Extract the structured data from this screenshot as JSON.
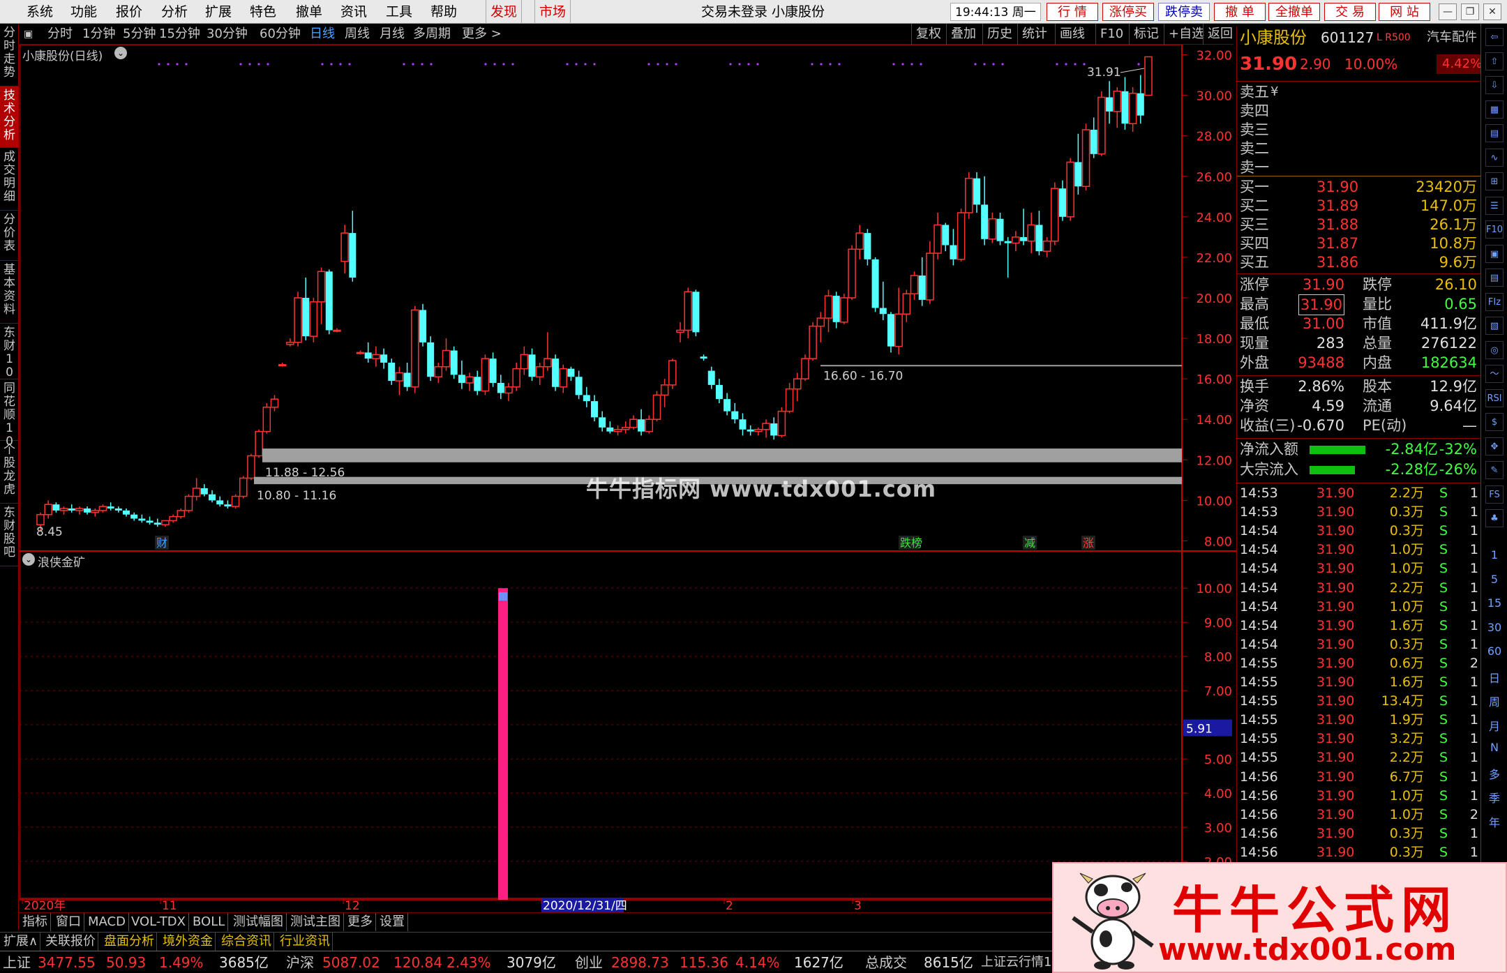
{
  "menubar": {
    "items": [
      "系统",
      "功能",
      "报价",
      "分析",
      "扩展",
      "特色",
      "撤单",
      "资讯",
      "工具",
      "帮助"
    ],
    "highlight_items": [
      "发现",
      "市场"
    ],
    "title": "交易未登录  小康股份",
    "clock": "19:44:13 周一",
    "quick_buttons": [
      "行  情",
      "涨停买",
      "跌停卖",
      "撤  单",
      "全撤单",
      "交  易",
      "网  站"
    ],
    "window_buttons": [
      "—",
      "❐",
      "✕"
    ]
  },
  "left_tabs": [
    "分时走势",
    "技术分析",
    "成交明细",
    "分价表",
    "基本资料",
    "东财10",
    "同花顺10",
    "个股龙虎",
    "东财股吧"
  ],
  "left_tabs_active": "技术分析",
  "period_bar": {
    "periods": [
      "分时",
      "1分钟",
      "5分钟",
      "15分钟",
      "30分钟",
      "60分钟",
      "日线",
      "周线",
      "月线",
      "多周期",
      "更多 >"
    ],
    "selected": "日线",
    "tools": [
      "复权",
      "叠加",
      "历史",
      "统计",
      "画线",
      "F10",
      "标记",
      "+自选",
      "返回"
    ]
  },
  "main_chart": {
    "title": "小康股份(日线)",
    "price_axis_ticks": [
      "32.00",
      "30.00",
      "28.00",
      "26.00",
      "24.00",
      "22.00",
      "20.00",
      "18.00",
      "16.00",
      "14.00",
      "12.00",
      "10.00",
      "8.00"
    ],
    "annotations": {
      "high_label": "31.91",
      "low_label": "8.45",
      "band1_label": "16.60 - 16.70",
      "band2_label": "11.88 - 12.56",
      "band3_label": "10.80 - 11.16",
      "event_marks": [
        "财",
        "跌榜",
        "减",
        "涨"
      ]
    }
  },
  "indicator": {
    "title": "浪侠金矿",
    "axis_ticks": [
      "10.00",
      "9.00",
      "8.00",
      "7.00",
      "6.00",
      "5.00",
      "4.00",
      "3.00",
      "2.00"
    ],
    "current_value": "5.91",
    "bar_value": 10.0,
    "bar_color": "#ff1e82"
  },
  "date_axis": [
    "2020年",
    "11",
    "12",
    "2020/12/31/四",
    "2",
    "3"
  ],
  "chart_data": {
    "type": "candlestick",
    "symbol": "小康股份",
    "period": "日线",
    "y_range": [
      7.5,
      32.5
    ],
    "candles": [
      [
        8.8,
        9.4,
        8.5,
        9.3
      ],
      [
        9.3,
        10.0,
        9.1,
        9.8
      ],
      [
        9.8,
        9.9,
        9.4,
        9.5
      ],
      [
        9.5,
        9.7,
        9.3,
        9.6
      ],
      [
        9.6,
        9.8,
        9.4,
        9.5
      ],
      [
        9.5,
        9.7,
        9.3,
        9.6
      ],
      [
        9.6,
        9.7,
        9.3,
        9.4
      ],
      [
        9.4,
        9.6,
        9.2,
        9.5
      ],
      [
        9.5,
        9.8,
        9.4,
        9.7
      ],
      [
        9.7,
        9.9,
        9.5,
        9.6
      ],
      [
        9.6,
        9.7,
        9.4,
        9.5
      ],
      [
        9.5,
        9.6,
        9.2,
        9.3
      ],
      [
        9.3,
        9.4,
        9.0,
        9.1
      ],
      [
        9.1,
        9.3,
        8.9,
        9.0
      ],
      [
        9.0,
        9.2,
        8.8,
        8.9
      ],
      [
        8.9,
        9.1,
        8.7,
        8.8
      ],
      [
        8.8,
        9.0,
        8.7,
        9.0
      ],
      [
        9.0,
        9.3,
        8.9,
        9.2
      ],
      [
        9.2,
        9.6,
        9.1,
        9.5
      ],
      [
        9.5,
        10.3,
        9.4,
        10.2
      ],
      [
        10.2,
        11.1,
        10.0,
        10.6
      ],
      [
        10.6,
        10.8,
        10.2,
        10.3
      ],
      [
        10.3,
        10.5,
        9.9,
        10.0
      ],
      [
        10.0,
        10.2,
        9.7,
        9.8
      ],
      [
        9.8,
        10.0,
        9.6,
        9.7
      ],
      [
        9.7,
        10.3,
        9.6,
        10.2
      ],
      [
        10.2,
        11.2,
        10.1,
        11.1
      ],
      [
        11.1,
        12.3,
        11.0,
        12.2
      ],
      [
        12.2,
        13.5,
        12.1,
        13.4
      ],
      [
        13.4,
        14.8,
        13.3,
        14.6
      ],
      [
        14.6,
        15.2,
        14.4,
        15.0
      ],
      [
        16.7,
        16.8,
        16.6,
        16.7
      ],
      [
        17.7,
        18.0,
        17.6,
        17.8
      ],
      [
        17.8,
        20.3,
        17.6,
        20.0
      ],
      [
        20.0,
        21.0,
        17.9,
        18.1
      ],
      [
        18.1,
        20.0,
        17.8,
        19.8
      ],
      [
        19.8,
        21.5,
        18.7,
        21.3
      ],
      [
        21.3,
        21.4,
        18.2,
        18.4
      ],
      [
        18.4,
        18.5,
        18.3,
        18.4
      ],
      [
        21.8,
        23.6,
        21.2,
        23.2
      ],
      [
        23.2,
        24.3,
        20.8,
        21.0
      ],
      [
        17.3,
        17.4,
        17.2,
        17.3
      ],
      [
        17.3,
        17.8,
        16.8,
        17.0
      ],
      [
        17.0,
        17.6,
        16.6,
        17.2
      ],
      [
        17.2,
        17.5,
        16.5,
        16.8
      ],
      [
        16.8,
        17.0,
        15.7,
        15.9
      ],
      [
        15.9,
        16.6,
        15.2,
        16.3
      ],
      [
        16.3,
        16.8,
        15.4,
        15.6
      ],
      [
        15.6,
        19.6,
        15.3,
        19.4
      ],
      [
        19.4,
        19.7,
        17.6,
        17.8
      ],
      [
        17.8,
        18.1,
        15.9,
        16.1
      ],
      [
        16.1,
        16.8,
        15.8,
        16.6
      ],
      [
        16.6,
        18.0,
        16.4,
        17.4
      ],
      [
        17.4,
        17.6,
        16.0,
        16.2
      ],
      [
        16.2,
        16.9,
        15.5,
        15.8
      ],
      [
        15.8,
        16.3,
        15.4,
        16.1
      ],
      [
        16.1,
        16.4,
        15.2,
        15.4
      ],
      [
        15.4,
        17.2,
        15.2,
        17.0
      ],
      [
        17.0,
        17.3,
        15.6,
        15.8
      ],
      [
        15.8,
        16.2,
        15.0,
        15.3
      ],
      [
        15.3,
        15.8,
        14.9,
        15.6
      ],
      [
        15.6,
        16.8,
        15.4,
        16.5
      ],
      [
        16.5,
        17.6,
        16.2,
        17.2
      ],
      [
        17.2,
        17.5,
        15.9,
        16.1
      ],
      [
        16.1,
        16.8,
        15.7,
        16.6
      ],
      [
        16.6,
        18.3,
        16.4,
        17.0
      ],
      [
        17.0,
        17.2,
        15.4,
        15.6
      ],
      [
        15.6,
        16.7,
        15.3,
        16.5
      ],
      [
        16.5,
        16.6,
        15.9,
        16.1
      ],
      [
        16.1,
        16.4,
        15.0,
        15.2
      ],
      [
        15.2,
        15.6,
        14.6,
        14.9
      ],
      [
        14.9,
        15.2,
        13.9,
        14.1
      ],
      [
        14.1,
        14.4,
        13.4,
        13.6
      ],
      [
        13.6,
        13.9,
        13.3,
        13.4
      ],
      [
        13.4,
        13.7,
        13.2,
        13.5
      ],
      [
        13.5,
        13.9,
        13.3,
        13.6
      ],
      [
        13.6,
        14.2,
        13.5,
        14.0
      ],
      [
        14.0,
        14.5,
        13.2,
        13.4
      ],
      [
        13.4,
        14.2,
        13.3,
        14.0
      ],
      [
        14.0,
        15.4,
        13.9,
        15.2
      ],
      [
        15.2,
        16.0,
        14.6,
        15.7
      ],
      [
        15.7,
        17.0,
        15.5,
        16.9
      ],
      [
        18.3,
        18.8,
        17.8,
        18.4
      ],
      [
        18.4,
        20.5,
        18.0,
        20.3
      ],
      [
        20.3,
        20.4,
        18.1,
        18.3
      ],
      [
        17.1,
        17.2,
        16.9,
        17.0
      ],
      [
        16.4,
        16.6,
        15.5,
        15.7
      ],
      [
        15.7,
        16.0,
        14.8,
        15.0
      ],
      [
        15.0,
        15.3,
        14.2,
        14.4
      ],
      [
        14.4,
        14.8,
        13.8,
        14.0
      ],
      [
        14.0,
        14.3,
        13.2,
        13.5
      ],
      [
        13.5,
        13.7,
        13.2,
        13.4
      ],
      [
        13.4,
        13.6,
        13.2,
        13.5
      ],
      [
        13.5,
        14.0,
        13.1,
        13.8
      ],
      [
        13.8,
        14.1,
        13.0,
        13.2
      ],
      [
        13.2,
        14.6,
        13.1,
        14.4
      ],
      [
        14.4,
        15.8,
        14.3,
        15.5
      ],
      [
        15.5,
        16.3,
        14.9,
        16.0
      ],
      [
        16.0,
        17.2,
        15.9,
        17.0
      ],
      [
        17.0,
        18.8,
        16.9,
        18.6
      ],
      [
        18.6,
        19.3,
        17.8,
        19.0
      ],
      [
        19.0,
        20.4,
        18.3,
        20.1
      ],
      [
        20.1,
        20.3,
        18.5,
        18.8
      ],
      [
        18.8,
        20.2,
        18.7,
        20.0
      ],
      [
        20.0,
        22.6,
        19.9,
        22.4
      ],
      [
        22.4,
        23.6,
        21.9,
        23.2
      ],
      [
        23.2,
        23.4,
        21.6,
        21.9
      ],
      [
        21.9,
        22.0,
        19.3,
        19.5
      ],
      [
        19.5,
        20.8,
        18.9,
        19.2
      ],
      [
        19.2,
        19.3,
        17.3,
        17.6
      ],
      [
        17.6,
        20.5,
        17.2,
        19.2
      ],
      [
        19.2,
        20.4,
        18.8,
        20.2
      ],
      [
        20.2,
        21.3,
        19.9,
        21.1
      ],
      [
        21.1,
        22.0,
        19.6,
        19.9
      ],
      [
        19.9,
        22.8,
        19.7,
        22.2
      ],
      [
        22.2,
        24.2,
        21.9,
        23.6
      ],
      [
        23.6,
        23.7,
        22.3,
        22.6
      ],
      [
        22.6,
        23.4,
        21.6,
        21.9
      ],
      [
        21.9,
        24.4,
        21.8,
        24.2
      ],
      [
        24.2,
        26.2,
        23.9,
        25.9
      ],
      [
        25.9,
        26.2,
        24.2,
        24.6
      ],
      [
        24.6,
        26.0,
        22.6,
        22.9
      ],
      [
        22.9,
        24.2,
        22.7,
        23.9
      ],
      [
        23.9,
        24.2,
        22.6,
        22.8
      ],
      [
        22.8,
        23.0,
        21.0,
        22.7
      ],
      [
        22.7,
        23.3,
        22.3,
        23.0
      ],
      [
        23.0,
        24.4,
        22.6,
        22.8
      ],
      [
        22.8,
        24.2,
        22.2,
        23.6
      ],
      [
        23.6,
        24.3,
        22.1,
        22.3
      ],
      [
        22.3,
        23.0,
        22.0,
        22.8
      ],
      [
        22.8,
        25.7,
        22.6,
        25.4
      ],
      [
        25.4,
        25.8,
        23.8,
        24.0
      ],
      [
        24.0,
        26.9,
        23.8,
        26.7
      ],
      [
        26.7,
        28.1,
        25.1,
        25.5
      ],
      [
        25.5,
        28.6,
        25.3,
        28.3
      ],
      [
        28.3,
        28.9,
        26.9,
        27.1
      ],
      [
        27.1,
        30.2,
        27.0,
        29.9
      ],
      [
        29.9,
        30.7,
        28.6,
        29.2
      ],
      [
        29.2,
        30.4,
        28.4,
        30.2
      ],
      [
        30.2,
        30.9,
        28.3,
        28.6
      ],
      [
        28.6,
        30.4,
        28.2,
        30.1
      ],
      [
        30.1,
        31.0,
        28.6,
        29.0
      ],
      [
        30.0,
        31.9,
        31.0,
        31.9
      ]
    ]
  },
  "quote": {
    "name": "小康股份",
    "code": "601127",
    "tags": "L R500",
    "sector": "汽车配件",
    "price": "31.90",
    "change": "2.90",
    "change_pct": "10.00%",
    "amplitude": "4.42%",
    "asks": [
      {
        "label": "卖五",
        "price": "",
        "vol": ""
      },
      {
        "label": "卖四",
        "price": "",
        "vol": ""
      },
      {
        "label": "卖三",
        "price": "",
        "vol": ""
      },
      {
        "label": "卖二",
        "price": "",
        "vol": ""
      },
      {
        "label": "卖一",
        "price": "",
        "vol": ""
      }
    ],
    "ask_currency": "¥",
    "bids": [
      {
        "label": "买一",
        "price": "31.90",
        "vol": "23420万"
      },
      {
        "label": "买二",
        "price": "31.89",
        "vol": "147.0万"
      },
      {
        "label": "买三",
        "price": "31.88",
        "vol": "26.1万"
      },
      {
        "label": "买四",
        "price": "31.87",
        "vol": "10.8万"
      },
      {
        "label": "买五",
        "price": "31.86",
        "vol": "9.6万"
      }
    ],
    "stats": [
      {
        "l1": "涨停",
        "v1": "31.90",
        "l2": "跌停",
        "v2": "26.10"
      },
      {
        "l1": "最高",
        "v1": "31.90",
        "l2": "量比",
        "v2": "0.65"
      },
      {
        "l1": "最低",
        "v1": "31.00",
        "l2": "市值",
        "v2": "411.9亿"
      },
      {
        "l1": "现量",
        "v1": "283",
        "l2": "总量",
        "v2": "276122"
      },
      {
        "l1": "外盘",
        "v1": "93488",
        "l2": "内盘",
        "v2": "182634"
      }
    ],
    "stats2": [
      {
        "l1": "换手",
        "v1": "2.86%",
        "l2": "股本",
        "v2": "12.9亿"
      },
      {
        "l1": "净资",
        "v1": "4.59",
        "l2": "流通",
        "v2": "9.64亿"
      },
      {
        "l1": "收益(三)",
        "v1": "-0.670",
        "l2": "PE(动)",
        "v2": "—"
      }
    ],
    "flows": [
      {
        "label": "净流入额",
        "value": "-2.84亿",
        "pct": "-32%",
        "fill": 0.32
      },
      {
        "label": "大宗流入",
        "value": "-2.28亿",
        "pct": "-26%",
        "fill": 0.26
      }
    ]
  },
  "ticks": [
    {
      "t": "14:53",
      "p": "31.90",
      "v": "2.2万",
      "s": "S",
      "n": "1"
    },
    {
      "t": "14:53",
      "p": "31.90",
      "v": "0.3万",
      "s": "S",
      "n": "1"
    },
    {
      "t": "14:54",
      "p": "31.90",
      "v": "0.3万",
      "s": "S",
      "n": "1"
    },
    {
      "t": "14:54",
      "p": "31.90",
      "v": "1.0万",
      "s": "S",
      "n": "1"
    },
    {
      "t": "14:54",
      "p": "31.90",
      "v": "1.0万",
      "s": "S",
      "n": "1"
    },
    {
      "t": "14:54",
      "p": "31.90",
      "v": "2.2万",
      "s": "S",
      "n": "1"
    },
    {
      "t": "14:54",
      "p": "31.90",
      "v": "1.0万",
      "s": "S",
      "n": "1"
    },
    {
      "t": "14:54",
      "p": "31.90",
      "v": "1.6万",
      "s": "S",
      "n": "1"
    },
    {
      "t": "14:54",
      "p": "31.90",
      "v": "0.3万",
      "s": "S",
      "n": "1"
    },
    {
      "t": "14:55",
      "p": "31.90",
      "v": "0.6万",
      "s": "S",
      "n": "2"
    },
    {
      "t": "14:55",
      "p": "31.90",
      "v": "1.6万",
      "s": "S",
      "n": "1"
    },
    {
      "t": "14:55",
      "p": "31.90",
      "v": "13.4万",
      "s": "S",
      "n": "1"
    },
    {
      "t": "14:55",
      "p": "31.90",
      "v": "1.9万",
      "s": "S",
      "n": "1"
    },
    {
      "t": "14:55",
      "p": "31.90",
      "v": "3.2万",
      "s": "S",
      "n": "1"
    },
    {
      "t": "14:55",
      "p": "31.90",
      "v": "2.2万",
      "s": "S",
      "n": "1"
    },
    {
      "t": "14:56",
      "p": "31.90",
      "v": "6.7万",
      "s": "S",
      "n": "1"
    },
    {
      "t": "14:56",
      "p": "31.90",
      "v": "1.0万",
      "s": "S",
      "n": "1"
    },
    {
      "t": "14:56",
      "p": "31.90",
      "v": "1.0万",
      "s": "S",
      "n": "2"
    },
    {
      "t": "14:56",
      "p": "31.90",
      "v": "0.3万",
      "s": "S",
      "n": "1"
    },
    {
      "t": "14:56",
      "p": "31.90",
      "v": "0.3万",
      "s": "S",
      "n": "1"
    }
  ],
  "right_strip": {
    "icons": [
      "arrow-left-icon",
      "arrow-up-icon",
      "arrow-down-icon",
      "table-icon",
      "grid-icon",
      "line-chart-icon",
      "candle-icon",
      "list-icon",
      "f10-icon",
      "book-icon",
      "note-icon",
      "fiz-icon",
      "calendar-icon",
      "circle-icon",
      "wave-icon",
      "rsi-icon",
      "money-icon",
      "move-icon",
      "pencil-icon",
      "fs-icon",
      "fx-icon"
    ],
    "icon_text": [
      "⇦",
      "⇧",
      "⇩",
      "▦",
      "▤",
      "∿",
      "⊞",
      "☰",
      "F10",
      "▣",
      "▤",
      "FIz",
      "▧",
      "◎",
      "〜",
      "RSI",
      "$",
      "✥",
      "✎",
      "FS",
      "♣"
    ],
    "periods": [
      "1",
      "5",
      "15",
      "30",
      "60",
      "日",
      "周",
      "月",
      "N",
      "多",
      "季",
      "年"
    ]
  },
  "bottom_tabs": [
    "指标",
    "窗口",
    "MACD",
    "VOL-TDX",
    "BOLL",
    "测试幅图",
    "测试主图",
    "更多",
    "设置"
  ],
  "ext_bar": [
    {
      "label": "扩展∧",
      "color": "#c8c8c8"
    },
    {
      "label": "关联报价",
      "color": "#c8c8c8"
    },
    {
      "label": "盘面分析",
      "color": "#e8c000"
    },
    {
      "label": "境外资金",
      "color": "#e8c000"
    },
    {
      "label": "综合资讯",
      "color": "#e8c000"
    },
    {
      "label": "行业资讯",
      "color": "#e8c000"
    }
  ],
  "status_bar": {
    "sh": {
      "name": "上证",
      "price": "3477.55",
      "chg": "50.93",
      "pct": "1.49%",
      "amt": "3685亿"
    },
    "hs": {
      "name": "沪深",
      "price": "5087.02",
      "chg": "120.84",
      "pct": "2.43%",
      "amt": "3079亿"
    },
    "cy": {
      "name": "创业",
      "price": "2898.73",
      "chg": "115.36",
      "pct": "4.14%",
      "amt": "1627亿"
    },
    "total_label": "总成交",
    "total": "8615亿",
    "ticker": "上证云行情1"
  },
  "watermark_center": "牛牛指标网 www.tdx001.com",
  "logo": {
    "title": "牛牛公式网",
    "url": "www.tdx001.com"
  },
  "colors": {
    "up": "#ff3232",
    "down": "#54ffff",
    "grid": "#7a0000",
    "axis": "#c00000",
    "magenta": "#ff1e82"
  }
}
